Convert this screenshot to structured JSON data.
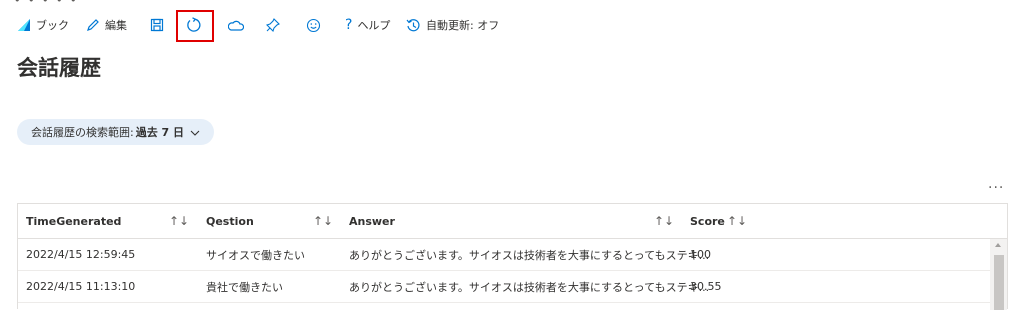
{
  "toolbar": {
    "workbook_label": "ブック",
    "edit_label": "編集",
    "help_label": "ヘルプ",
    "auto_refresh_label": "自動更新: オフ"
  },
  "page": {
    "title": "会話履歴"
  },
  "filter": {
    "label": "会話履歴の検索範囲:",
    "value": "過去 7 日"
  },
  "table": {
    "columns": [
      "TimeGenerated",
      "Qestion",
      "Answer",
      "Score"
    ],
    "sort_glyph": "↑↓",
    "rows": [
      {
        "time": "2022/4/15 12:59:45",
        "question": "サイオスで働きたい",
        "answer": "ありがとうございます。サイオスは技術者を大事にするとってもステキ...",
        "score": "100"
      },
      {
        "time": "2022/4/15 11:13:10",
        "question": "貴社で働きたい",
        "answer": "ありがとうございます。サイオスは技術者を大事にするとってもステキ...",
        "score": "30.55"
      }
    ]
  },
  "more_label": "...",
  "colors": {
    "accent": "#0078d4",
    "highlight": "#e00000",
    "pill_bg": "#e6eff9"
  }
}
